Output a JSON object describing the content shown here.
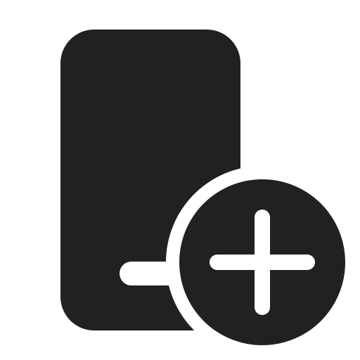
{
  "icon": {
    "name": "phone-add-icon",
    "color": "#212121",
    "background": "#ffffff"
  }
}
